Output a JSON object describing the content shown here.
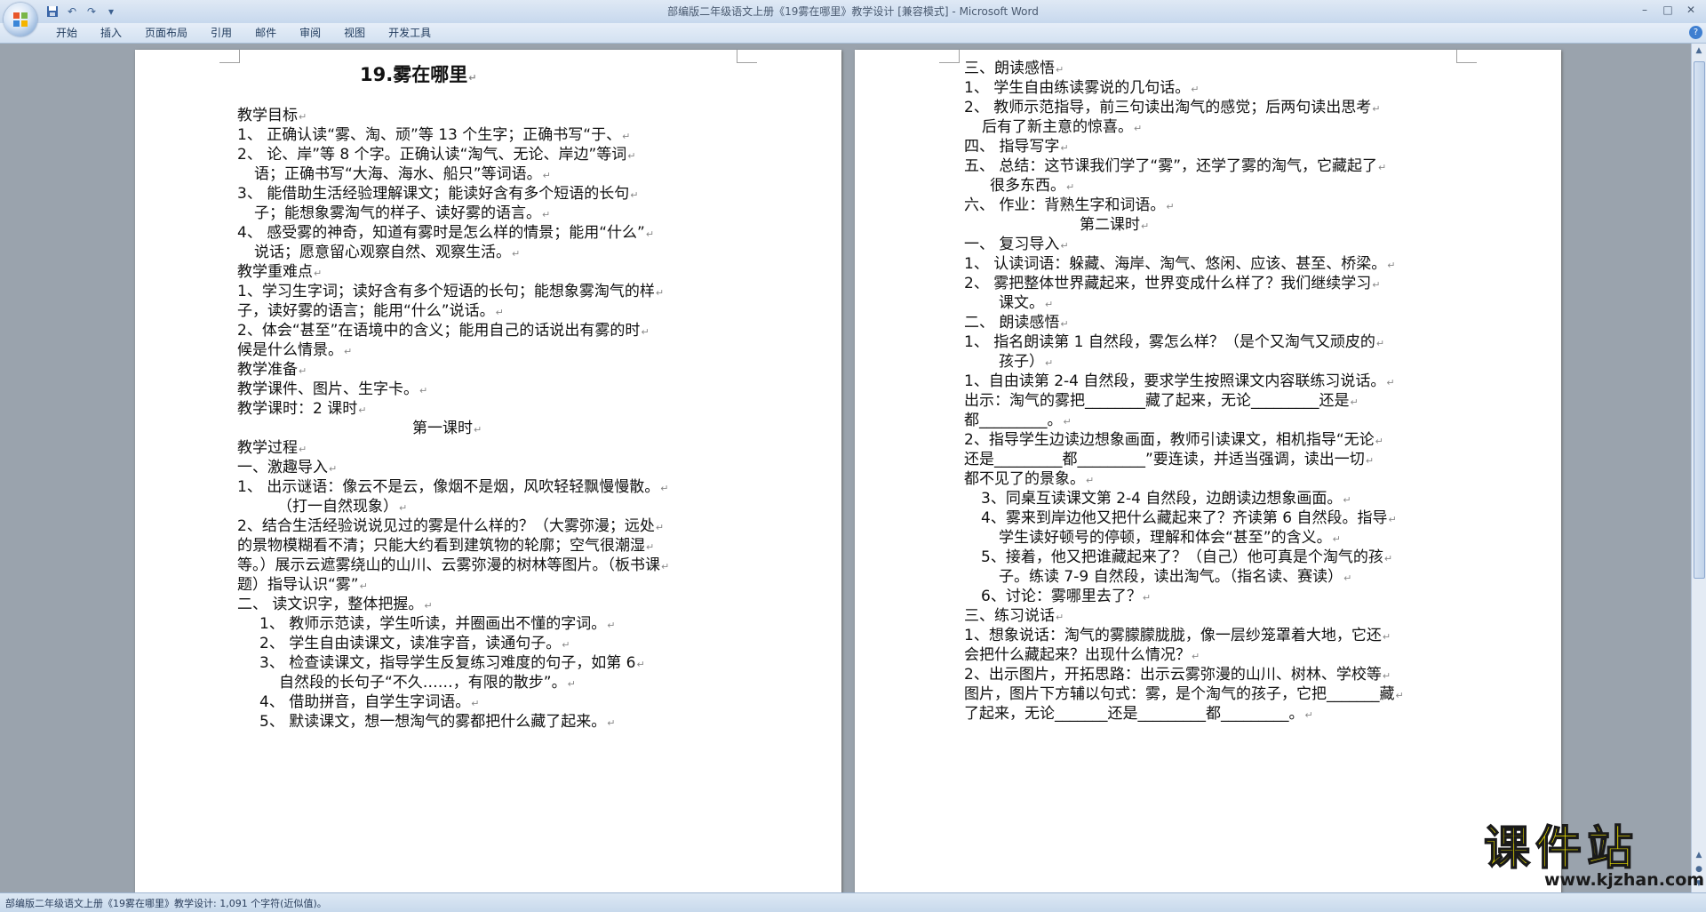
{
  "window": {
    "title": "部编版二年级语文上册《19雾在哪里》教学设计 [兼容模式] - Microsoft Word",
    "controls": [
      "–",
      "□",
      "✕"
    ]
  },
  "qat": {
    "icons": [
      "save-icon",
      "undo-icon",
      "redo-icon",
      "customize-icon"
    ]
  },
  "ribbon": {
    "tabs": [
      "开始",
      "插入",
      "页面布局",
      "引用",
      "邮件",
      "审阅",
      "视图",
      "开发工具"
    ],
    "help": "?"
  },
  "status": {
    "text": "部编版二年级语文上册《19雾在哪里》教学设计: 1,091 个字符(近似值)。"
  },
  "watermark": {
    "name": "课件站",
    "url": "www.kjzhan.com"
  },
  "page1": {
    "lines": [
      "19.雾在哪里",
      "教学目标",
      "1、    正确认读“雾、淘、顽”等 13 个生字；正确书写“于、",
      "2、    论、岸”等 8 个字。正确认读“淘气、无论、岸边”等词",
      "语；正确书写“大海、海水、船只”等词语。",
      "3、    能借助生活经验理解课文；能读好含有多个短语的长句",
      "子；能想象雾淘气的样子、读好雾的语言。",
      "4、    感受雾的神奇，知道有雾时是怎么样的情景；能用“什么”",
      "说话；愿意留心观察自然、观察生活。",
      "教学重难点",
      "1、学习生字词；读好含有多个短语的长句；能想象雾淘气的样",
      "子，读好雾的语言；能用“什么”说话。",
      "2、体会“甚至”在语境中的含义；能用自己的话说出有雾的时",
      "候是什么情景。",
      "教学准备",
      "教学课件、图片、生字卡。",
      "教学课时：2 课时",
      "第一课时",
      "教学过程",
      "一、激趣导入",
      "1、   出示谜语：像云不是云，像烟不是烟，风吹轻轻飘慢慢散。",
      "（打一自然现象）",
      "2、结合生活经验说说见过的雾是什么样的？（大雾弥漫；远处",
      "的景物模糊看不清；只能大约看到建筑物的轮廓；空气很潮湿",
      "等。）展示云遮雾绕山的山川、云雾弥漫的树林等图片。（板书课",
      "题）指导认识“雾”",
      "二、  读文识字，整体把握。",
      "1、    教师示范读，学生听读，并圈画出不懂的字词。",
      "2、    学生自由读课文，读准字音，读通句子。",
      "3、    检查读课文，指导学生反复练习难度的句子，如第 6",
      "自然段的长句子“不久……，有限的散步”。",
      "4、    借助拼音，自学生字词语。",
      "5、    默读课文，想一想淘气的雾都把什么藏了起来。"
    ]
  },
  "page2": {
    "lines": [
      "三、朗读感悟",
      "1、    学生自由练读雾说的几句话。",
      "2、    教师示范指导，前三句读出淘气的感觉；后两句读出思考",
      "后有了新主意的惊喜。",
      "四、 指导写字",
      "五、 总结：这节课我们学了“雾”，还学了雾的淘气，它藏起了",
      "很多东西。",
      "六、 作业：背熟生字和词语。",
      "第二课时",
      "一、  复习导入",
      "1、   认读词语：躲藏、海岸、淘气、悠闲、应该、甚至、桥梁。",
      "2、   雾把整体世界藏起来，世界变成什么样了？我们继续学习",
      "课文。",
      "二、  朗读感悟",
      "1、   指名朗读第 1 自然段，雾怎么样？（是个又淘气又顽皮的",
      "孩子）",
      "1、自由读第 2-4 自然段，要求学生按照课文内容联练习说话。",
      "出示：淘气的雾把________藏了起来，无论_________还是",
      "都_________。",
      "2、指导学生边读边想象画面，教师引读课文，相机指导“无论",
      "还是_________都_________”要连读，并适当强调，读出一切",
      "都不见了的景象。",
      "3、同桌互读课文第 2-4 自然段，边朗读边想象画面。",
      "4、雾来到岸边他又把什么藏起来了？齐读第 6 自然段。指导",
      "学生读好顿号的停顿，理解和体会“甚至”的含义。",
      "5、接着，他又把谁藏起来了？（自己）他可真是个淘气的孩",
      "子。练读 7-9 自然段，读出淘气。（指名读、赛读）",
      "6、讨论：雾哪里去了？",
      "三、练习说话",
      "1、想象说话：淘气的雾朦朦胧胧，像一层纱笼罩着大地，它还",
      "会把什么藏起来？出现什么情况？",
      "2、出示图片，开拓思路：出示云雾弥漫的山川、树林、学校等",
      "图片，图片下方辅以句式：雾，是个淘气的孩子，它把_______藏",
      "了起来，无论_______还是_________都_________。"
    ]
  }
}
